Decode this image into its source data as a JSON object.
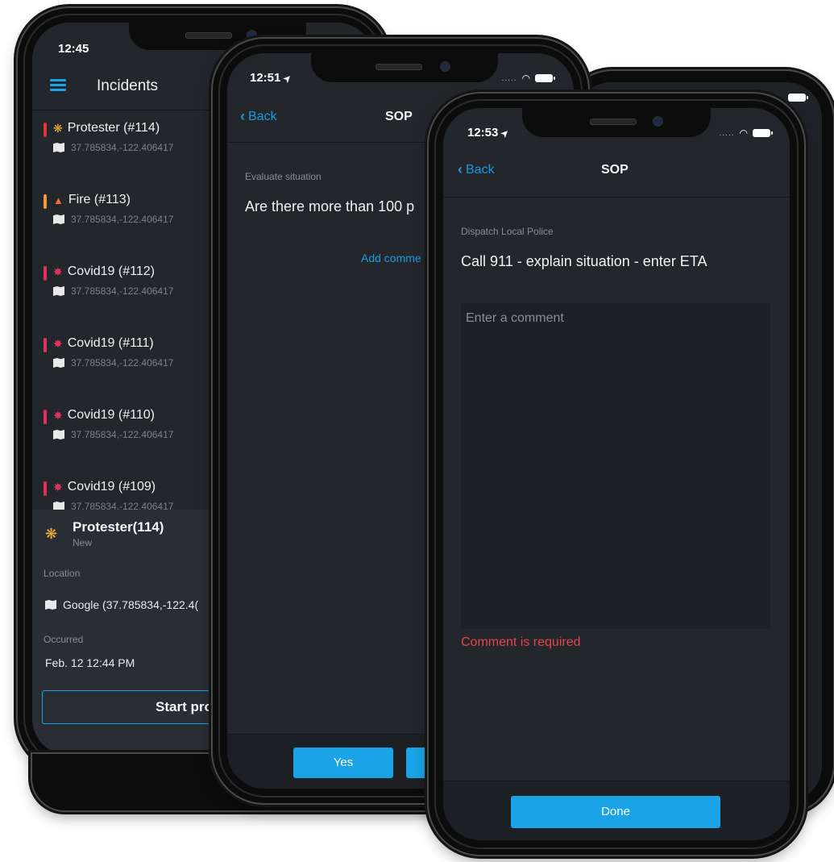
{
  "phone1": {
    "time": "12:45",
    "title": "Incidents",
    "items": [
      {
        "title": "Protester (#114)",
        "coords": "37.785834,-122.406417",
        "color": "#e0323a",
        "icon": "people-icon",
        "glyph": "❋"
      },
      {
        "title": "Fire (#113)",
        "coords": "37.785834,-122.406417",
        "color": "#f29a3a",
        "icon": "flame-icon",
        "glyph": "🔥"
      },
      {
        "title": "Covid19 (#112)",
        "coords": "37.785834,-122.406417",
        "color": "#e0325e",
        "icon": "virus-icon",
        "glyph": "✸"
      },
      {
        "title": "Covid19 (#111)",
        "coords": "37.785834,-122.406417",
        "color": "#e0325e",
        "icon": "virus-icon",
        "glyph": "✸"
      },
      {
        "title": "Covid19 (#110)",
        "coords": "37.785834,-122.406417",
        "color": "#e0325e",
        "icon": "virus-icon",
        "glyph": "✸"
      },
      {
        "title": "Covid19 (#109)",
        "coords": "37.785834,-122.406417",
        "color": "#e0325e",
        "icon": "virus-icon",
        "glyph": "✸"
      }
    ],
    "detail": {
      "name": "Protester(114)",
      "status": "New",
      "location_label": "Location",
      "location_value": "Google (37.785834,-122.4(",
      "occurred_label": "Occurred",
      "occurred_value": "Feb. 12 12:44  PM",
      "start_button": "Start pro"
    }
  },
  "phone2": {
    "time": "12:51",
    "back": "Back",
    "title": "SOP",
    "section_label": "Evaluate situation",
    "question": "Are there more than 100 p",
    "add_comment": "Add comme",
    "yes_button": "Yes"
  },
  "phone3": {
    "time": "12:53",
    "back": "Back",
    "title": "SOP",
    "section_label": "Dispatch Local Police",
    "instruction": "Call 911 - explain situation - enter ETA",
    "comment_placeholder": "Enter a comment",
    "error": "Comment is required",
    "done_button": "Done"
  },
  "colors": {
    "accent": "#1aa3e6",
    "error": "#e0474c",
    "background": "#23262b"
  }
}
